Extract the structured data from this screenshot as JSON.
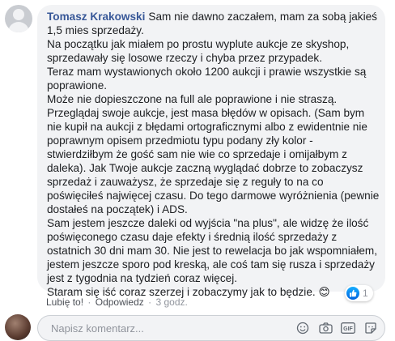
{
  "comment": {
    "author": "Tomasz Krakowski",
    "lines": [
      "Sam nie dawno zaczałem, mam za sobą jakieś",
      "1,5 mies sprzedaży.",
      "Na początku jak miałem po prostu wyplute aukcje ze skyshop,",
      "sprzedawały się losowe rzeczy i chyba przez przypadek.",
      "Teraz mam wystawionych około 1200 aukcji i prawie wszystkie są",
      "poprawione.",
      "Może nie dopieszczone na full ale poprawione i nie straszą.",
      "Przeglądaj swoje aukcje, jest masa błędów w opisach. (Sam bym",
      "nie kupił na aukcji z błędami ortograficznymi albo z ewidentnie nie",
      "poprawnym opisem przedmiotu typu podany zły kolor -",
      "stwierdziłbym że gość sam nie wie co sprzedaje i omijałbym z",
      "daleka). Jak Twoje aukcje zaczną wyglądać dobrze to zobaczysz",
      "sprzedaż i zauważysz, że sprzedaje się z reguły to na co",
      "poświęciłeś najwięcej czasu. Do tego darmowe wyróżnienia (pewnie",
      "dostałeś na początek) i ADS.",
      "Sam jestem jeszcze daleki od wyjścia \"na plus\", ale widzę że ilość",
      "poświęconego czasu daje efekty i średnią ilość sprzedaży z",
      "ostatnich 30 dni mam 30. Nie jest to rewelacja bo jak wspomniałem,",
      "jestem jeszcze sporo pod kreską, ale coś tam się rusza i sprzedaży",
      "jest z tygodnia na tydzień coraz więcej.",
      "Staram się iść coraz szerzej i zobaczymy jak to będzie."
    ],
    "emoji": "😊",
    "reaction_count": "1",
    "actions": {
      "like": "Lubię to!",
      "reply": "Odpowiedz",
      "time": "3 godz."
    }
  },
  "composer": {
    "placeholder": "Napisz komentarz..."
  },
  "icons": {
    "like": "thumbs-up-icon",
    "emoji": "smiley-icon",
    "camera": "camera-icon",
    "gif": "gif-icon",
    "sticker": "sticker-icon"
  },
  "colors": {
    "author": "#385898",
    "bubble": "#f2f3f5",
    "meta": "#90949c",
    "like_blue": "#0062df"
  }
}
